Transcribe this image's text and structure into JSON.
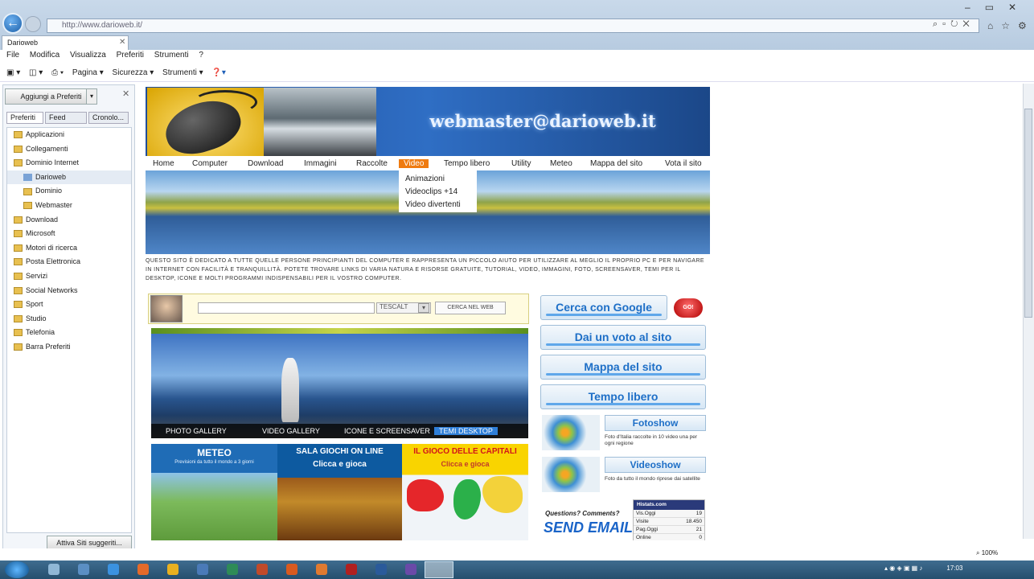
{
  "browser": {
    "url": "http://www.darioweb.it/",
    "tab_title": "Darioweb",
    "menu": [
      "File",
      "Modifica",
      "Visualizza",
      "Preferiti",
      "Strumenti",
      "?"
    ],
    "command_bar": [
      "Pagina ▾",
      "Sicurezza ▾",
      "Strumenti ▾"
    ],
    "zoom": "100%",
    "clock": "17:03"
  },
  "favorites": {
    "add_button": "Aggiungi a Preferiti",
    "tabs": [
      "Preferiti",
      "Feed",
      "Cronolo..."
    ],
    "items": [
      {
        "label": "Applicazioni",
        "level": 0
      },
      {
        "label": "Collegamenti",
        "level": 0
      },
      {
        "label": "Dominio Internet",
        "level": 0
      },
      {
        "label": "Darioweb",
        "level": 1,
        "selected": true
      },
      {
        "label": "Dominio",
        "level": 1
      },
      {
        "label": "Webmaster",
        "level": 1
      },
      {
        "label": "Download",
        "level": 0
      },
      {
        "label": "Microsoft",
        "level": 0
      },
      {
        "label": "Motori di ricerca",
        "level": 0
      },
      {
        "label": "Posta Elettronica",
        "level": 0
      },
      {
        "label": "Servizi",
        "level": 0
      },
      {
        "label": "Social Networks",
        "level": 0
      },
      {
        "label": "Sport",
        "level": 0
      },
      {
        "label": "Studio",
        "level": 0
      },
      {
        "label": "Telefonia",
        "level": 0
      },
      {
        "label": "Barra Preferiti",
        "level": 0
      }
    ],
    "suggest_button": "Attiva Siti suggeriti..."
  },
  "site": {
    "email_banner": "webmaster@darioweb.it",
    "nav": [
      "Home",
      "Computer",
      "Download",
      "Immagini",
      "Raccolte",
      "Video",
      "Tempo libero",
      "Utility",
      "Meteo",
      "Mappa del sito",
      "Vota il sito"
    ],
    "video_dropdown": [
      "Animazioni",
      "Videoclips +14",
      "Video divertenti"
    ],
    "intro": "Questo sito è dedicato a tutte quelle persone principianti del computer e rappresenta un piccolo aiuto per utilizzare al meglio il proprio PC e per navigare in internet con facilità e tranquillità. Potete trovare links di varia natura e risorse gratuite, tutorial, video, immagini, foto, screensaver, temi per il desktop, icone e molti programmi indispensabili per il vostro computer.",
    "search": {
      "select": "TESCALT",
      "button": "CERCA NEL WEB"
    },
    "gallery": [
      "PHOTO GALLERY",
      "VIDEO GALLERY",
      "ICONE E SCREENSAVER",
      "TEMI DESKTOP"
    ],
    "tiles": [
      {
        "title": "METEO",
        "sub": "Previsioni da tutto il mondo a 3 giorni"
      },
      {
        "title": "SALA GIOCHI ON LINE",
        "sub": "Clicca e gioca"
      },
      {
        "title": "IL GIOCO DELLE CAPITALI",
        "sub": "Clicca e gioca"
      }
    ],
    "right_buttons": [
      "Cerca con Google",
      "Dai un voto al sito",
      "Mappa  del  sito",
      "Tempo libero"
    ],
    "go_label": "GO!",
    "fotoshow": {
      "title": "Fotoshow",
      "text": "Foto d'Italia raccolte in 10 video una per ogni regione"
    },
    "videoshow": {
      "title": "Videoshow",
      "text": "Foto da tutto il mondo riprese dai satellite"
    },
    "send": {
      "small": "Questions? Comments?",
      "big": "SEND EMAIL"
    },
    "stats": {
      "header": "Histats.com",
      "rows": [
        {
          "k": "Vis.Oggi",
          "v": "19"
        },
        {
          "k": "Visite",
          "v": "18.450"
        },
        {
          "k": "Pag.Oggi",
          "v": "21"
        },
        {
          "k": "Online",
          "v": "0"
        }
      ]
    }
  }
}
